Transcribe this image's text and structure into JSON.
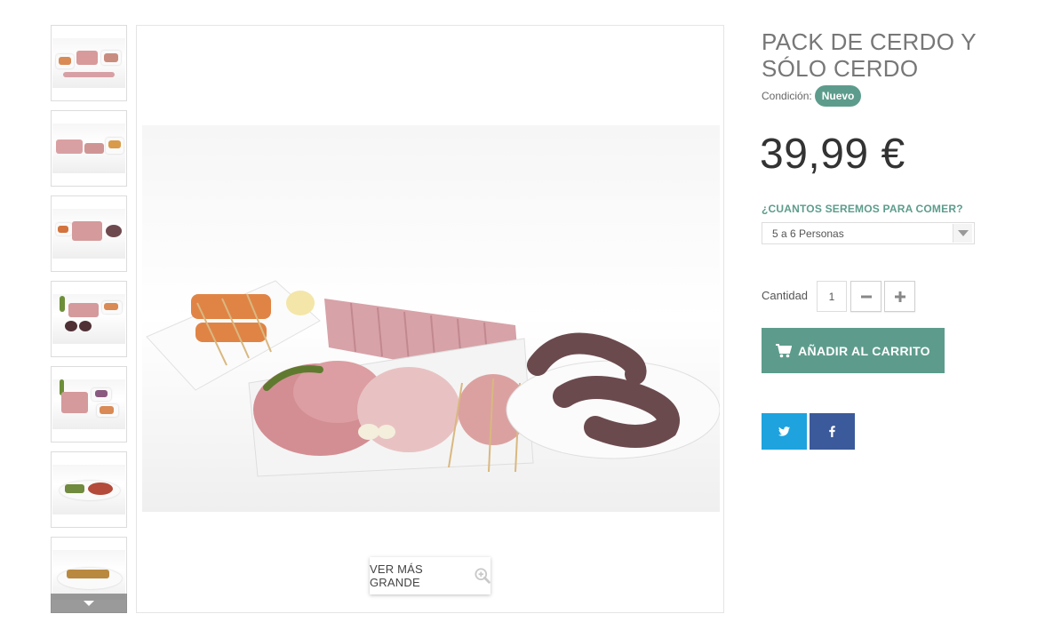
{
  "product": {
    "title": "PACK DE CERDO Y SÓLO CERDO",
    "condition_label": "Condición:",
    "condition_value": "Nuevo",
    "price": "39,99 €"
  },
  "options": {
    "label": "¿CUANTOS SEREMOS PARA COMER?",
    "selected": "5 a 6 Personas"
  },
  "quantity": {
    "label": "Cantidad",
    "value": "1"
  },
  "actions": {
    "add_to_cart": "AÑADIR AL CARRITO",
    "view_larger": "VER MÁS GRANDE"
  },
  "gallery": {
    "thumbnail_count": 7
  },
  "icons": {
    "cart": "shopping-cart-icon",
    "zoom": "zoom-in-icon",
    "twitter": "twitter-icon",
    "facebook": "facebook-icon",
    "minus": "minus-icon",
    "plus": "plus-icon",
    "chevron": "chevron-down-icon"
  },
  "colors": {
    "accent": "#5d9c8c",
    "twitter": "#1ea3de",
    "facebook": "#3b5a9b"
  }
}
